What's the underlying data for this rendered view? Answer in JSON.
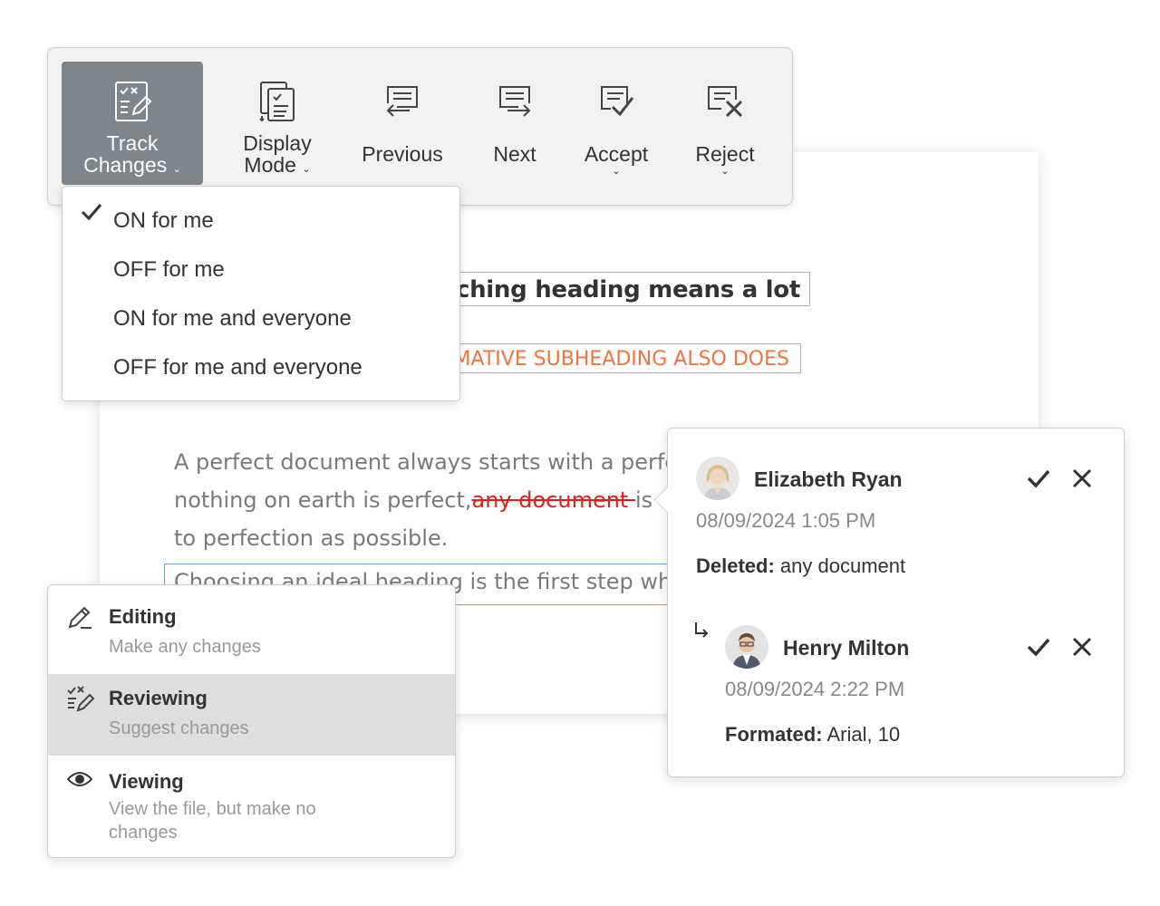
{
  "document": {
    "heading_fragment": "tching heading means a lot",
    "subheading_fragment": "MATIVE SUBHEADING ALSO DOES",
    "para_line1": "A perfect document always starts with a perfe",
    "para_line2_before": "nothing on earth is perfect,",
    "para_line2_deleted": "any document ",
    "para_line2_after": " is",
    "para_line3": "to perfection as possible.",
    "selected_line": "Choosing an ideal heading is the first step wh"
  },
  "toolbar": {
    "buttons": [
      {
        "label": "Track Changes",
        "icon": "track-changes-icon",
        "active": true
      },
      {
        "label": "Display Mode",
        "icon": "display-mode-icon"
      },
      {
        "label": "Previous",
        "icon": "previous-change-icon"
      },
      {
        "label": "Next",
        "icon": "next-change-icon"
      },
      {
        "label": "Accept",
        "icon": "accept-change-icon"
      },
      {
        "label": "Reject",
        "icon": "reject-change-icon"
      }
    ],
    "track_line1": "Track",
    "track_line2": "Changes",
    "display_line1": "Display",
    "display_line2": "Mode",
    "previous": "Previous",
    "next": "Next",
    "accept": "Accept",
    "reject": "Reject"
  },
  "track_changes_menu": {
    "items": [
      {
        "label": "ON for me",
        "checked": true
      },
      {
        "label": "OFF for me",
        "checked": false
      },
      {
        "label": "ON for me and everyone",
        "checked": false
      },
      {
        "label": "OFF for me and everyone",
        "checked": false
      }
    ]
  },
  "mode_panel": {
    "items": [
      {
        "title": "Editing",
        "description": "Make any changes",
        "icon": "pencil-icon",
        "selected": false
      },
      {
        "title": "Reviewing",
        "description": "Suggest changes",
        "icon": "review-icon",
        "selected": true
      },
      {
        "title": "Viewing",
        "description": "View the file, but make no changes",
        "icon": "eye-icon",
        "selected": false
      }
    ]
  },
  "comment": {
    "entries": [
      {
        "author": "Elizabeth Ryan",
        "date": "08/09/2024 1:05 PM",
        "detail_label": "Deleted:",
        "detail_value": " any document"
      },
      {
        "author": "Henry Milton",
        "date": "08/09/2024 2:22 PM",
        "detail_label": "Formated:",
        "detail_value": " Arial, 10"
      }
    ]
  },
  "colors": {
    "toolbar_bg": "#f2f2f2",
    "active_button": "#7e868c",
    "deleted_text": "#e02020",
    "subheading": "#f0743c",
    "selected_mode_bg": "#dedede"
  }
}
